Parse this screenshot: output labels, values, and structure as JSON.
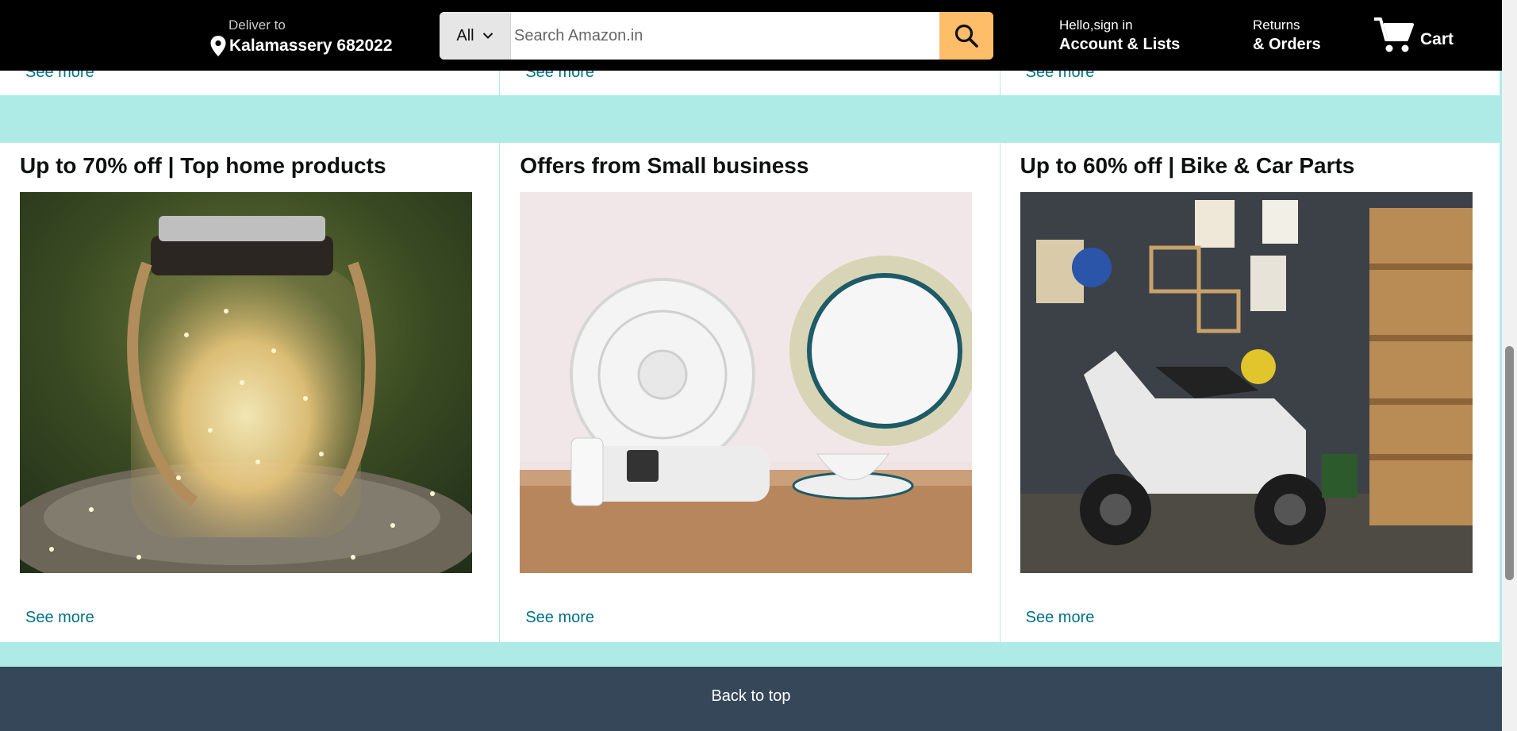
{
  "header": {
    "deliver_label": "Deliver to",
    "deliver_location": "Kalamassery 682022",
    "search_category": "All",
    "search_placeholder": "Search Amazon.in",
    "account_greeting": "Hello,sign in",
    "account_label": "Account & Lists",
    "returns_line1": "Returns",
    "returns_line2": "& Orders",
    "cart_label": "Cart"
  },
  "top_strip": {
    "links": [
      "See more",
      "See more",
      "See more"
    ]
  },
  "cards": [
    {
      "title": "Up to 70% off | Top home products",
      "link": "See more",
      "image": "fairy-light-lantern-jar"
    },
    {
      "title": "Offers from Small business",
      "link": "See more",
      "image": "table-fan-and-dinnerware"
    },
    {
      "title": "Up to 60% off | Bike & Car Parts",
      "link": "See more",
      "image": "scooter-in-garage"
    }
  ],
  "footer": {
    "back_to_top": "Back to top"
  },
  "colors": {
    "header_bg": "#000000",
    "search_button": "#febd69",
    "link": "#007185",
    "page_bg": "#aeebe7",
    "back_to_top_bg": "#37475a"
  },
  "icons": [
    "location-pin-icon",
    "chevron-down-icon",
    "search-icon",
    "cart-icon"
  ]
}
